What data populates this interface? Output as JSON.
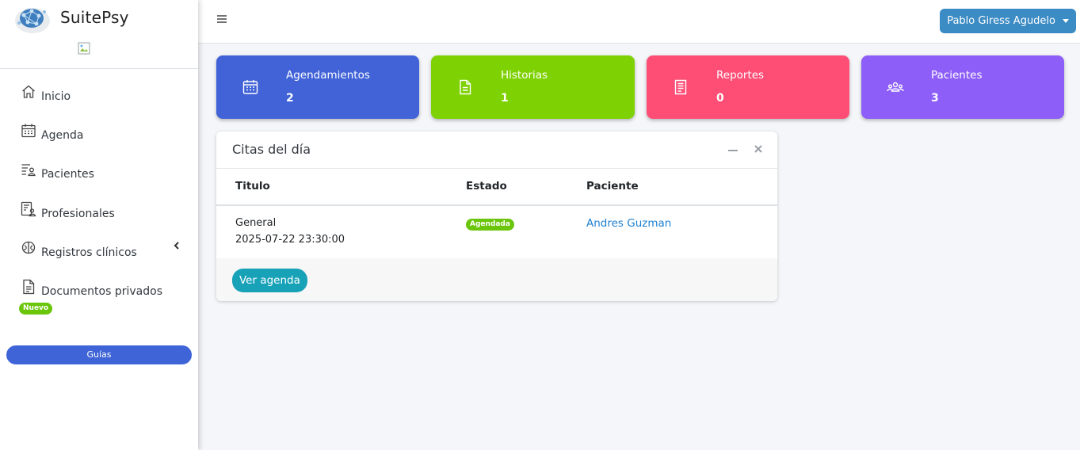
{
  "brand": {
    "name": "SuitePsy",
    "logo_icon": "brain-network-logo",
    "image_icon": "broken-image-icon"
  },
  "sidebar": {
    "items": [
      {
        "label": "Inicio",
        "icon": "home-icon"
      },
      {
        "label": "Agenda",
        "icon": "calendar-icon"
      },
      {
        "label": "Pacientes",
        "icon": "user-list-icon"
      },
      {
        "label": "Profesionales",
        "icon": "user-doc-icon"
      },
      {
        "label": "Registros clínicos",
        "icon": "brain-icon",
        "chevron": "chevron-left-icon"
      },
      {
        "label": "Documentos privados",
        "icon": "file-icon",
        "badge": "Nuevo"
      }
    ],
    "guides_label": "Guías"
  },
  "topbar": {
    "menu_icon": "hamburger-icon",
    "user_name": "Pablo Giress Agudelo"
  },
  "info_boxes": [
    {
      "label": "Agendamientos",
      "value": "2",
      "color": "#4163d7",
      "icon": "calendar-icon"
    },
    {
      "label": "Historias",
      "value": "1",
      "color": "#7ed103",
      "icon": "document-icon"
    },
    {
      "label": "Reportes",
      "value": "0",
      "color": "#fe4e76",
      "icon": "report-icon"
    },
    {
      "label": "Pacientes",
      "value": "3",
      "color": "#8d5ef8",
      "icon": "users-icon"
    }
  ],
  "appointments_card": {
    "title": "Citas del día",
    "columns": [
      "Titulo",
      "Estado",
      "Paciente"
    ],
    "rows": [
      {
        "title": "General",
        "datetime": "2025-07-22 23:30:00",
        "status": "Agendada",
        "patient": "Andres Guzman"
      }
    ],
    "button_label": "Ver agenda"
  },
  "colors": {
    "accent_blue": "#3e64d7",
    "badge_green": "#6ac50b",
    "link_blue": "#1c7fcf",
    "button_teal": "#17a2b8",
    "user_button": "#3b8bc4"
  }
}
